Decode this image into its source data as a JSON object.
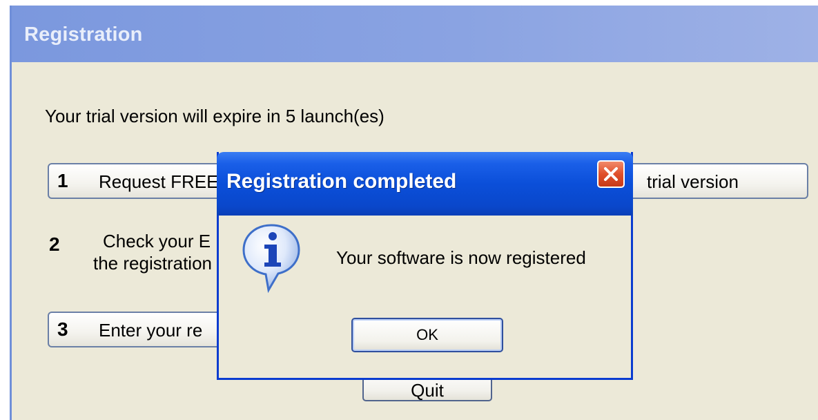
{
  "main_window": {
    "title": "Registration",
    "trial_text": "Your trial version will expire in 5 launch(es)",
    "step1": {
      "number": "1",
      "label": "Request FREE",
      "label_tail": "trial version"
    },
    "step2": {
      "number": "2",
      "line1": "Check your E",
      "line2": "the registration"
    },
    "step3": {
      "number": "3",
      "label": "Enter your re"
    },
    "quit_label": "Quit"
  },
  "dialog": {
    "title": "Registration completed",
    "message": "Your software is now registered",
    "ok_label": "OK",
    "icon": "info-icon",
    "close_icon": "close-icon"
  },
  "colors": {
    "dialog_title_bar": "#0b4fd9",
    "window_bg": "#ece9d8",
    "close_button": "#e0502c"
  }
}
